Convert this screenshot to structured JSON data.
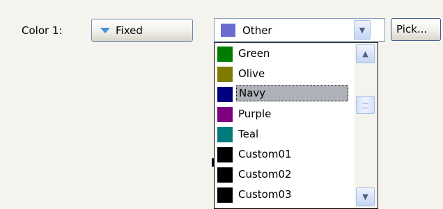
{
  "form": {
    "color_label": "Color 1:",
    "fixed_label": "Fixed",
    "combo_value": "Other",
    "combo_swatch_color": "#6b6bd0",
    "pick_label": "Pick..."
  },
  "dropdown": {
    "items": [
      {
        "label": "Green",
        "color": "#007c00"
      },
      {
        "label": "Olive",
        "color": "#7f7b00"
      },
      {
        "label": "Navy",
        "color": "#00007f",
        "selected": true
      },
      {
        "label": "Purple",
        "color": "#7f007f"
      },
      {
        "label": "Teal",
        "color": "#007b7b"
      },
      {
        "label": "Custom01",
        "color": "#000000"
      },
      {
        "label": "Custom02",
        "color": "#000000"
      },
      {
        "label": "Custom03",
        "color": "#000000"
      }
    ]
  },
  "icons": {
    "fixed": "triangle-down-icon",
    "combo_arrow": "chevron-down-icon",
    "scroll_up": "chevron-up-icon",
    "scroll_down": "chevron-down-icon"
  }
}
